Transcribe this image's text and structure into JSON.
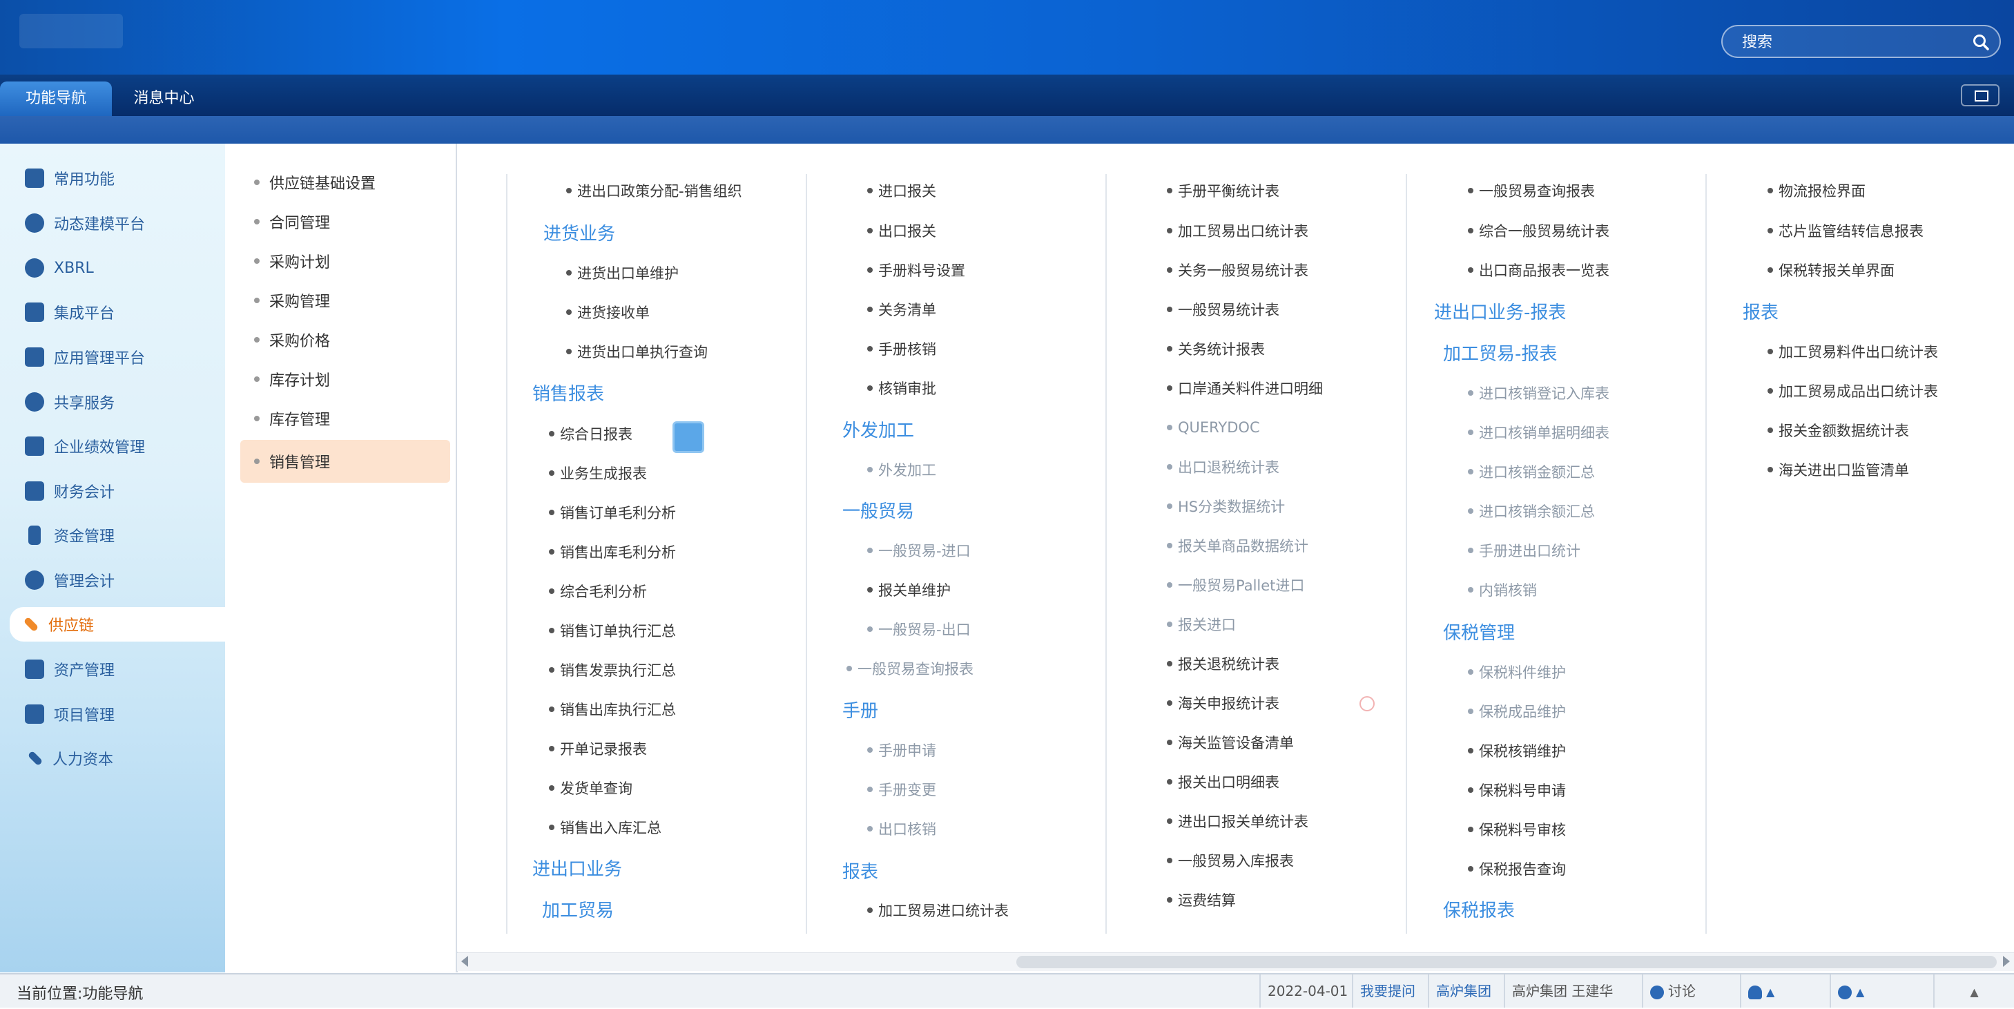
{
  "header": {
    "search_placeholder": "搜索"
  },
  "tabs": [
    {
      "label": "功能导航"
    },
    {
      "label": "消息中心"
    }
  ],
  "leftnav": {
    "items": [
      {
        "label": "常用功能"
      },
      {
        "label": "动态建模平台"
      },
      {
        "label": "XBRL"
      },
      {
        "label": "集成平台"
      },
      {
        "label": "应用管理平台"
      },
      {
        "label": "共享服务"
      },
      {
        "label": "企业绩效管理"
      },
      {
        "label": "财务会计"
      },
      {
        "label": "资金管理"
      },
      {
        "label": "管理会计"
      },
      {
        "label": "供应链"
      },
      {
        "label": "资产管理"
      },
      {
        "label": "项目管理"
      },
      {
        "label": "人力资本"
      }
    ]
  },
  "submenu": {
    "items": [
      {
        "label": "供应链基础设置"
      },
      {
        "label": "合同管理"
      },
      {
        "label": "采购计划"
      },
      {
        "label": "采购管理"
      },
      {
        "label": "采购价格"
      },
      {
        "label": "库存计划"
      },
      {
        "label": "库存管理"
      },
      {
        "label": "销售管理"
      }
    ]
  },
  "menu": {
    "col1": {
      "items": [
        {
          "label": "进出口政策分配-销售组织",
          "kind": "item"
        },
        {
          "label": "进货业务",
          "kind": "head"
        },
        {
          "label": "进货出口单维护",
          "kind": "item"
        },
        {
          "label": "进货接收单",
          "kind": "item"
        },
        {
          "label": "进货出口单执行查询",
          "kind": "item"
        },
        {
          "label": "销售报表",
          "kind": "head"
        },
        {
          "label": "综合日报表",
          "kind": "item"
        },
        {
          "label": "业务生成报表",
          "kind": "item"
        },
        {
          "label": "销售订单毛利分析",
          "kind": "item"
        },
        {
          "label": "销售出库毛利分析",
          "kind": "item"
        },
        {
          "label": "综合毛利分析",
          "kind": "item"
        },
        {
          "label": "销售订单执行汇总",
          "kind": "item"
        },
        {
          "label": "销售发票执行汇总",
          "kind": "item"
        },
        {
          "label": "销售出库执行汇总",
          "kind": "item"
        },
        {
          "label": "开单记录报表",
          "kind": "item"
        },
        {
          "label": "发货单查询",
          "kind": "item"
        },
        {
          "label": "销售出入库汇总",
          "kind": "item"
        },
        {
          "label": "进出口业务",
          "kind": "head"
        },
        {
          "label": "加工贸易",
          "kind": "head"
        }
      ]
    },
    "col2": {
      "items": [
        {
          "label": "进口报关",
          "kind": "item"
        },
        {
          "label": "出口报关",
          "kind": "item"
        },
        {
          "label": "手册料号设置",
          "kind": "item"
        },
        {
          "label": "关务清单",
          "kind": "item"
        },
        {
          "label": "手册核销",
          "kind": "item"
        },
        {
          "label": "核销审批",
          "kind": "item"
        },
        {
          "label": "外发加工",
          "kind": "head"
        },
        {
          "label": "外发加工",
          "kind": "item"
        },
        {
          "label": "一般贸易",
          "kind": "head"
        },
        {
          "label": "一般贸易-进口",
          "kind": "item"
        },
        {
          "label": "报关单维护",
          "kind": "item"
        },
        {
          "label": "一般贸易-出口",
          "kind": "item"
        },
        {
          "label": "一般贸易查询报表",
          "kind": "item"
        },
        {
          "label": "手册",
          "kind": "head"
        },
        {
          "label": "手册申请",
          "kind": "item"
        },
        {
          "label": "手册变更",
          "kind": "item"
        },
        {
          "label": "出口核销",
          "kind": "item"
        },
        {
          "label": "报表",
          "kind": "head"
        },
        {
          "label": "加工贸易进口统计表",
          "kind": "item"
        }
      ]
    },
    "col3": {
      "items": [
        {
          "label": "手册平衡统计表",
          "kind": "item"
        },
        {
          "label": "加工贸易出口统计表",
          "kind": "item"
        },
        {
          "label": "关务一般贸易统计表",
          "kind": "item"
        },
        {
          "label": "一般贸易统计表",
          "kind": "item"
        },
        {
          "label": "关务统计报表",
          "kind": "item"
        },
        {
          "label": "口岸通关料件进口明细",
          "kind": "item"
        },
        {
          "label": "QUERYDOC",
          "kind": "item"
        },
        {
          "label": "出口退税统计表",
          "kind": "item"
        },
        {
          "label": "HS分类数据统计",
          "kind": "item"
        },
        {
          "label": "报关单商品数据统计",
          "kind": "item"
        },
        {
          "label": "一般贸易Pallet进口",
          "kind": "item"
        },
        {
          "label": "报关进口",
          "kind": "item"
        },
        {
          "label": "报关退税统计表",
          "kind": "item"
        },
        {
          "label": "海关申报统计表",
          "kind": "item"
        },
        {
          "label": "海关监管设备清单",
          "kind": "item"
        },
        {
          "label": "报关出口明细表",
          "kind": "item"
        },
        {
          "label": "进出口报关单统计表",
          "kind": "item"
        },
        {
          "label": "一般贸易入库报表",
          "kind": "item"
        },
        {
          "label": "运费结算",
          "kind": "item"
        }
      ]
    },
    "col4": {
      "items": [
        {
          "label": "一般贸易查询报表",
          "kind": "item"
        },
        {
          "label": "综合一般贸易统计表",
          "kind": "item"
        },
        {
          "label": "出口商品报表一览表",
          "kind": "item"
        },
        {
          "label": "进出口业务-报表",
          "kind": "head"
        },
        {
          "label": "加工贸易-报表",
          "kind": "head"
        },
        {
          "label": "进口核销登记入库表",
          "kind": "item"
        },
        {
          "label": "进口核销单据明细表",
          "kind": "item"
        },
        {
          "label": "进口核销金额汇总",
          "kind": "item"
        },
        {
          "label": "进口核销余额汇总",
          "kind": "item"
        },
        {
          "label": "手册进出口统计",
          "kind": "item"
        },
        {
          "label": "内销核销",
          "kind": "item"
        },
        {
          "label": "保税管理",
          "kind": "head"
        },
        {
          "label": "保税料件维护",
          "kind": "item"
        },
        {
          "label": "保税成品维护",
          "kind": "item"
        },
        {
          "label": "保税核销维护",
          "kind": "item"
        },
        {
          "label": "保税料号申请",
          "kind": "item"
        },
        {
          "label": "保税料号审核",
          "kind": "item"
        },
        {
          "label": "保税报告查询",
          "kind": "item"
        },
        {
          "label": "保税报表",
          "kind": "head"
        }
      ]
    },
    "col5": {
      "items": [
        {
          "label": "物流报检界面",
          "kind": "item"
        },
        {
          "label": "芯片监管结转信息报表",
          "kind": "item"
        },
        {
          "label": "保税转报关单界面",
          "kind": "item"
        },
        {
          "label": "报表",
          "kind": "head"
        },
        {
          "label": "加工贸易料件出口统计表",
          "kind": "item"
        },
        {
          "label": "加工贸易成品出口统计表",
          "kind": "item"
        },
        {
          "label": "报关金额数据统计表",
          "kind": "item"
        },
        {
          "label": "海关进出口监管清单",
          "kind": "item"
        }
      ]
    }
  },
  "statusbar": {
    "location": "当前位置:功能导航",
    "date": "2022-04-01",
    "feedback": "我要提问",
    "company": "高炉集团",
    "user_org": "高炉集团",
    "user_name": "王建华",
    "discuss": "讨论"
  }
}
